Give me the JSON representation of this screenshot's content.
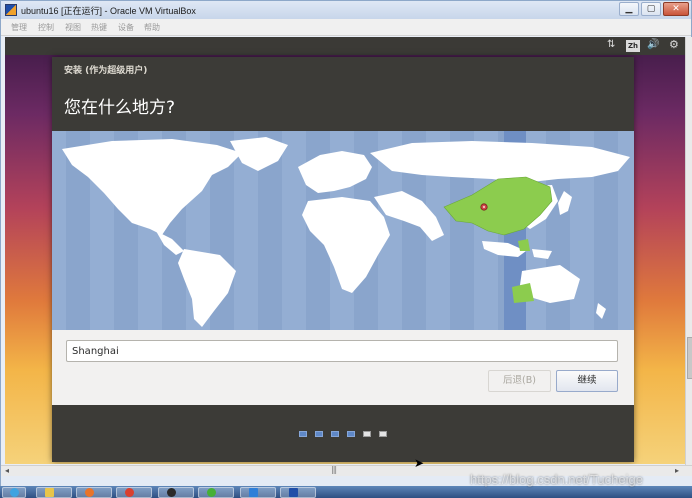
{
  "window": {
    "title": "ubuntu16 [正在运行] - Oracle VM VirtualBox",
    "minimize_glyph": "▁",
    "maximize_glyph": "▢",
    "close_glyph": "✕",
    "app_icon": "virtualbox-icon"
  },
  "menubar": {
    "items": [
      "管理",
      "控制",
      "视图",
      "热键",
      "设备",
      "帮助"
    ]
  },
  "guest_topbar": {
    "network_icon": "⇅",
    "language_indicator": "Zh",
    "volume_icon": "🔊",
    "settings_icon": "⚙"
  },
  "installer": {
    "title": "安装 (作为超级用户)",
    "question": "您在什么地方?",
    "location_value": "Shanghai",
    "back_label": "后退(B)",
    "continue_label": "继续",
    "steps_total": 6,
    "steps_completed": 4
  },
  "map": {
    "ocean_color": "#94aed3",
    "land_color": "#ffffff",
    "selected_region_color": "#8ccc4e",
    "highlighted_timezone_color": "#6f8fc4",
    "marker_color": "#cc4444"
  },
  "scrollbars": {
    "left_arrow": "◂",
    "right_arrow": "▸",
    "grip": "|||"
  },
  "taskbar": {
    "apps": [
      "start-orb",
      "explorer",
      "firefox",
      "chrome",
      "qq",
      "wechat",
      "xunlei",
      "virtualbox"
    ]
  },
  "watermark": "https://blog.csdn.net/Tucheige"
}
